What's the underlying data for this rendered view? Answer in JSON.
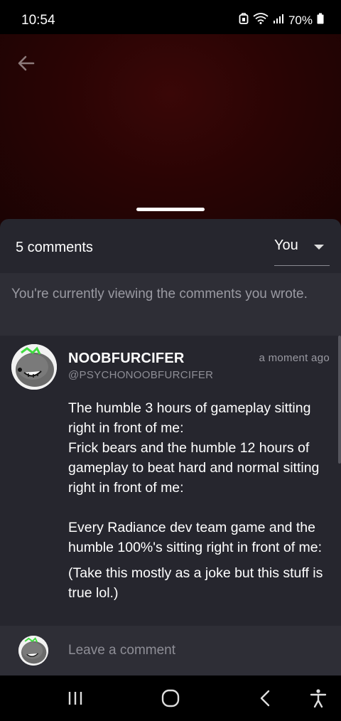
{
  "status_bar": {
    "time": "10:54",
    "battery": "70%",
    "icons": [
      "alarm-icon",
      "wifi-icon",
      "signal-icon",
      "battery-icon"
    ]
  },
  "header": {
    "back_icon": "back-arrow-icon",
    "accent_color": "#2a0404"
  },
  "sheet": {
    "comment_count": "5 comments",
    "filter": {
      "selected": "You",
      "icon": "caret-down-icon"
    },
    "notice": "You're currently viewing the comments you wrote."
  },
  "comments": [
    {
      "username": "NOOBFURCIFER",
      "handle": "@PSYCHONOOBFURCIFER",
      "timestamp": "a moment ago",
      "paragraphs": [
        "The humble 3 hours of gameplay sitting right in front of me:",
        "Frick bears and the humble 12 hours of gameplay to beat hard and normal sitting right in front of me:",
        "",
        "Every Radiance dev team game and the humble 100%'s sitting right in front of me:",
        "(Take this mostly as a joke but this stuff is true lol.)"
      ]
    }
  ],
  "composer": {
    "placeholder": "Leave a comment"
  },
  "nav_bar": {
    "icons": [
      "recent-apps-icon",
      "home-icon",
      "back-icon",
      "accessibility-icon"
    ]
  }
}
